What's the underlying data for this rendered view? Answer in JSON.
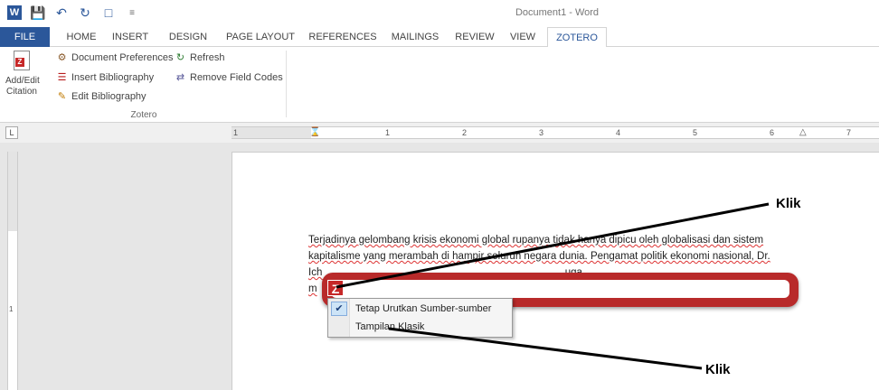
{
  "window": {
    "title": "Document1 - Word"
  },
  "tabs": [
    {
      "label": "FILE"
    },
    {
      "label": "HOME"
    },
    {
      "label": "INSERT"
    },
    {
      "label": "DESIGN"
    },
    {
      "label": "PAGE LAYOUT"
    },
    {
      "label": "REFERENCES"
    },
    {
      "label": "MAILINGS"
    },
    {
      "label": "REVIEW"
    },
    {
      "label": "VIEW"
    },
    {
      "label": "ZOTERO"
    }
  ],
  "ribbon": {
    "add_edit_citation": "Add/Edit Citation",
    "document_preferences": "Document Preferences",
    "insert_bibliography": "Insert Bibliography",
    "edit_bibliography": "Edit Bibliography",
    "refresh": "Refresh",
    "remove_field_codes": "Remove Field Codes",
    "group_label": "Zotero"
  },
  "ruler_numbers": [
    "1",
    "1",
    "2",
    "3",
    "4",
    "5",
    "6",
    "7"
  ],
  "document": {
    "line1": "Terjadinya gelombang krisis ekonomi global rupanya tidak hanya dipicu oleh globalisasi dan sistem",
    "line2": "kapitalisme yang merambah di hampir seluruh negara dunia. Pengamat politik ekonomi nasional, Dr.",
    "line3": "Ich                                                                                    uga",
    "line4": "m"
  },
  "zotero": {
    "logo": "Z"
  },
  "menu": {
    "items": [
      {
        "label": "Tetap Urutkan Sumber-sumber",
        "checked": true
      },
      {
        "label": "Tampilan Klasik",
        "checked": false
      }
    ]
  },
  "annotations": {
    "top": "Klik",
    "bottom": "Klik"
  },
  "colors": {
    "word_blue": "#2b579a",
    "zotero_red": "#b82a2a"
  }
}
